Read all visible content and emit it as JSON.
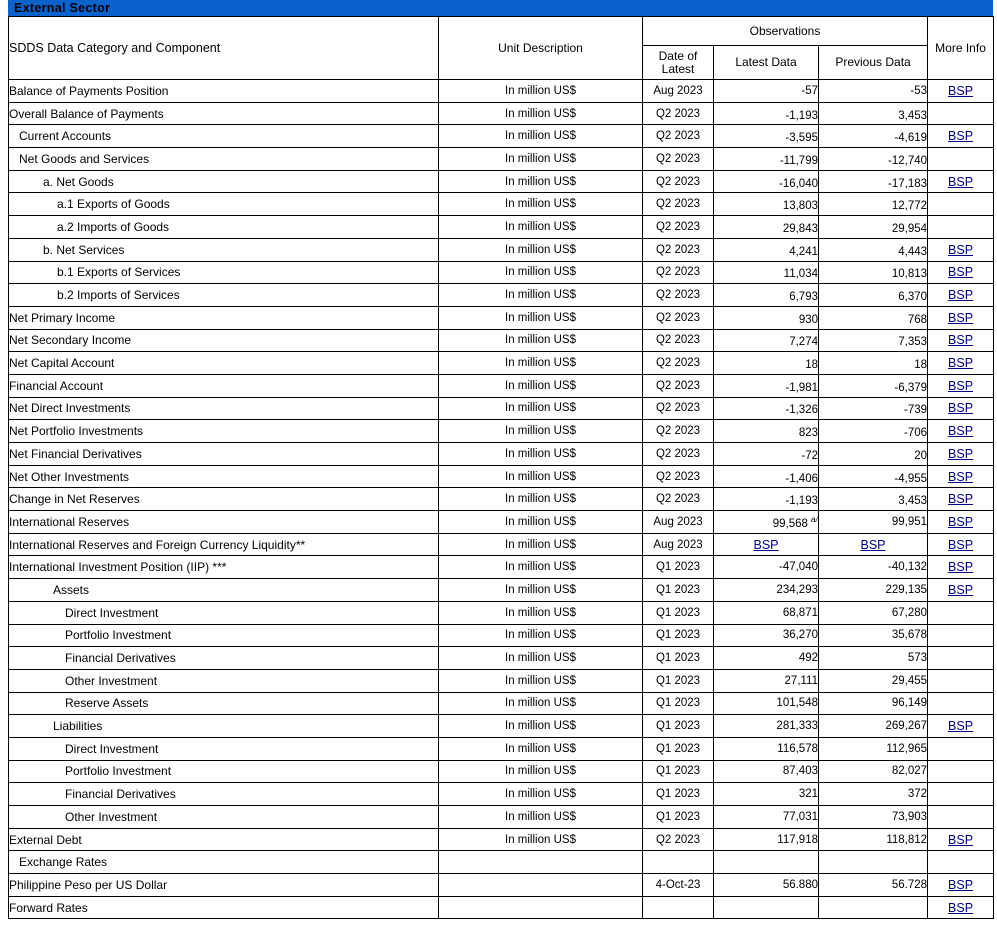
{
  "banner": {
    "title": "External Sector"
  },
  "colors": {
    "banner_blue": "#0b62cc",
    "link_blue": "#00008b",
    "border": "#000000"
  },
  "header": {
    "category": "SDDS Data Category and Component",
    "unit": "Unit Description",
    "observations": "Observations",
    "date_of_latest": "Date of\nLatest",
    "date_of_latest_line1": "Date of",
    "date_of_latest_line2": "Latest",
    "latest_data": "Latest Data",
    "previous_data": "Previous Data",
    "more_info": "More Info"
  },
  "link_label": "BSP",
  "footnote_marker": "a/",
  "rows": [
    {
      "name": "Balance of Payments Position",
      "bold": true,
      "indent": "",
      "unit": "In million US$",
      "date": "Aug 2023",
      "latest": "-57",
      "previous": "-53",
      "more": "BSP",
      "lowered": false
    },
    {
      "name": "Overall Balance of Payments",
      "bold": true,
      "indent": "",
      "unit": "In million US$",
      "date": "Q2 2023",
      "latest": "-1,193",
      "previous": "3,453",
      "more": "",
      "lowered": true
    },
    {
      "name": "Current Accounts",
      "bold": true,
      "indent": "ind-pad1",
      "unit": "In million US$",
      "date": "Q2 2023",
      "latest": "-3,595",
      "previous": "-4,619",
      "more": "BSP",
      "lowered": true
    },
    {
      "name": "Net Goods and Services",
      "bold": true,
      "indent": "ind-pad1",
      "unit": "In million US$",
      "date": "Q2 2023",
      "latest": "-11,799",
      "previous": "-12,740",
      "more": "",
      "lowered": true
    },
    {
      "name": "a.  Net Goods",
      "bold": false,
      "indent": "ind-a",
      "unit": "In million US$",
      "date": "Q2 2023",
      "latest": "-16,040",
      "previous": "-17,183",
      "more": "BSP",
      "lowered": true
    },
    {
      "name": "a.1    Exports of Goods",
      "bold": false,
      "indent": "ind-a2",
      "unit": "In million US$",
      "date": "Q2 2023",
      "latest": "13,803",
      "previous": "12,772",
      "more": "",
      "lowered": true
    },
    {
      "name": "a.2    Imports of Goods",
      "bold": false,
      "indent": "ind-a2",
      "unit": "In million US$",
      "date": "Q2 2023",
      "latest": "29,843",
      "previous": "29,954",
      "more": "",
      "lowered": true
    },
    {
      "name": "b.  Net Services",
      "bold": false,
      "indent": "ind-a",
      "unit": "In million US$",
      "date": "Q2 2023",
      "latest": "4,241",
      "previous": "4,443",
      "more": "BSP",
      "lowered": true
    },
    {
      "name": "b.1   Exports of Services",
      "bold": false,
      "indent": "ind-a2",
      "unit": "In million US$",
      "date": "Q2 2023",
      "latest": "11,034",
      "previous": "10,813",
      "more": "BSP",
      "lowered": true
    },
    {
      "name": "b.2   Imports of Services",
      "bold": false,
      "indent": "ind-a2",
      "unit": "In million US$",
      "date": "Q2 2023",
      "latest": "6,793",
      "previous": "6,370",
      "more": "BSP",
      "lowered": true
    },
    {
      "name": "Net Primary Income",
      "bold": false,
      "indent": "",
      "unit": "In million US$",
      "date": "Q2 2023",
      "latest": "930",
      "previous": "768",
      "more": "BSP",
      "lowered": true
    },
    {
      "name": "Net Secondary Income",
      "bold": false,
      "indent": "",
      "unit": "In million US$",
      "date": "Q2 2023",
      "latest": "7,274",
      "previous": "7,353",
      "more": "BSP",
      "lowered": true
    },
    {
      "name": "Net Capital Account",
      "bold": false,
      "indent": "",
      "unit": "In million US$",
      "date": "Q2 2023",
      "latest": "18",
      "previous": "18",
      "more": "BSP",
      "lowered": true
    },
    {
      "name": "Financial Account",
      "bold": false,
      "indent": "",
      "unit": "In million US$",
      "date": "Q2 2023",
      "latest": "-1,981",
      "previous": "-6,379",
      "more": "BSP",
      "lowered": true
    },
    {
      "name": "Net Direct Investments",
      "bold": false,
      "indent": "",
      "unit": "In million US$",
      "date": "Q2 2023",
      "latest": "-1,326",
      "previous": "-739",
      "more": "BSP",
      "lowered": true
    },
    {
      "name": "Net Portfolio Investments",
      "bold": false,
      "indent": "",
      "unit": "In million US$",
      "date": "Q2 2023",
      "latest": "823",
      "previous": "-706",
      "more": "BSP",
      "lowered": true
    },
    {
      "name": "Net  Financial Derivatives",
      "bold": false,
      "indent": "",
      "unit": "In million US$",
      "date": "Q2 2023",
      "latest": "-72",
      "previous": "20",
      "more": "BSP",
      "lowered": true
    },
    {
      "name": "Net Other Investments",
      "bold": false,
      "indent": "",
      "unit": "In million US$",
      "date": "Q2 2023",
      "latest": "-1,406",
      "previous": "-4,955",
      "more": "BSP",
      "lowered": true
    },
    {
      "name": "Change in Net Reserves",
      "bold": false,
      "indent": "",
      "unit": "In million US$",
      "date": "Q2 2023",
      "latest": "-1,193",
      "previous": "3,453",
      "more": "BSP",
      "lowered": true
    },
    {
      "name": "International Reserves",
      "bold": true,
      "indent": "",
      "unit": "In million US$",
      "date": "Aug 2023",
      "latest": "99,568",
      "previous": "99,951",
      "more": "BSP",
      "lowered": false,
      "footnote": "a/"
    },
    {
      "name": "International Reserves and Foreign Currency Liquidity**",
      "bold": true,
      "indent": "",
      "unit": "In million US$",
      "date": "Aug 2023",
      "latest": "BSP",
      "previous": "BSP",
      "more": "BSP",
      "lowered": false,
      "latest_is_link": true,
      "previous_is_link": true
    },
    {
      "name": "International Investment Position (IIP) ***",
      "bold": true,
      "indent": "",
      "unit": "In million US$",
      "date": "Q1 2023",
      "latest": "-47,040",
      "previous": "-40,132",
      "more": "BSP",
      "lowered": false
    },
    {
      "name": "Assets",
      "bold": false,
      "indent": "ind-L1",
      "unit": "In million US$",
      "date": "Q1 2023",
      "latest": "234,293",
      "previous": "229,135",
      "more": "BSP",
      "lowered": false
    },
    {
      "name": "Direct Investment",
      "bold": false,
      "indent": "ind-L2",
      "unit": "In million US$",
      "date": "Q1 2023",
      "latest": "68,871",
      "previous": "67,280",
      "more": "",
      "lowered": false
    },
    {
      "name": "Portfolio Investment",
      "bold": false,
      "indent": "ind-L2",
      "unit": "In million US$",
      "date": "Q1 2023",
      "latest": "36,270",
      "previous": "35,678",
      "more": "",
      "lowered": false
    },
    {
      "name": "Financial Derivatives",
      "bold": false,
      "indent": "ind-L2",
      "unit": "In million US$",
      "date": "Q1 2023",
      "latest": "492",
      "previous": "573",
      "more": "",
      "lowered": false
    },
    {
      "name": "Other Investment",
      "bold": false,
      "indent": "ind-L2",
      "unit": "In million US$",
      "date": "Q1 2023",
      "latest": "27,111",
      "previous": "29,455",
      "more": "",
      "lowered": false
    },
    {
      "name": "Reserve Assets",
      "bold": false,
      "indent": "ind-L2",
      "unit": "In million US$",
      "date": "Q1 2023",
      "latest": "101,548",
      "previous": "96,149",
      "more": "",
      "lowered": false
    },
    {
      "name": "Liabilities",
      "bold": false,
      "indent": "ind-L1",
      "unit": "In million US$",
      "date": "Q1 2023",
      "latest": "281,333",
      "previous": "269,267",
      "more": "BSP",
      "lowered": false
    },
    {
      "name": "Direct Investment",
      "bold": false,
      "indent": "ind-L2",
      "unit": "In million US$",
      "date": "Q1 2023",
      "latest": "116,578",
      "previous": "112,965",
      "more": "",
      "lowered": false
    },
    {
      "name": "Portfolio Investment",
      "bold": false,
      "indent": "ind-L2",
      "unit": "In million US$",
      "date": "Q1 2023",
      "latest": "87,403",
      "previous": "82,027",
      "more": "",
      "lowered": false
    },
    {
      "name": "Financial Derivatives",
      "bold": false,
      "indent": "ind-L2",
      "unit": "In million US$",
      "date": "Q1 2023",
      "latest": "321",
      "previous": "372",
      "more": "",
      "lowered": false
    },
    {
      "name": "Other Investment",
      "bold": false,
      "indent": "ind-L2",
      "unit": "In million US$",
      "date": "Q1 2023",
      "latest": "77,031",
      "previous": "73,903",
      "more": "",
      "lowered": false
    },
    {
      "name": "External Debt",
      "bold": true,
      "indent": "",
      "unit": "In million US$",
      "date": "Q2 2023",
      "latest": "117,918",
      "previous": "118,812",
      "more": "BSP",
      "lowered": false
    },
    {
      "name": "Exchange Rates",
      "bold": true,
      "indent": "ind-pad1",
      "unit": "",
      "date": "",
      "latest": "",
      "previous": "",
      "more": "",
      "lowered": false
    },
    {
      "name": "Philippine Peso per US Dollar",
      "bold": false,
      "indent": "",
      "unit": "",
      "date": "4-Oct-23",
      "latest": "56.880",
      "previous": "56.728",
      "more": "BSP",
      "lowered": false
    },
    {
      "name": "Forward Rates",
      "bold": false,
      "indent": "",
      "unit": "",
      "date": "",
      "latest": "",
      "previous": "",
      "more": "BSP",
      "lowered": false
    }
  ]
}
